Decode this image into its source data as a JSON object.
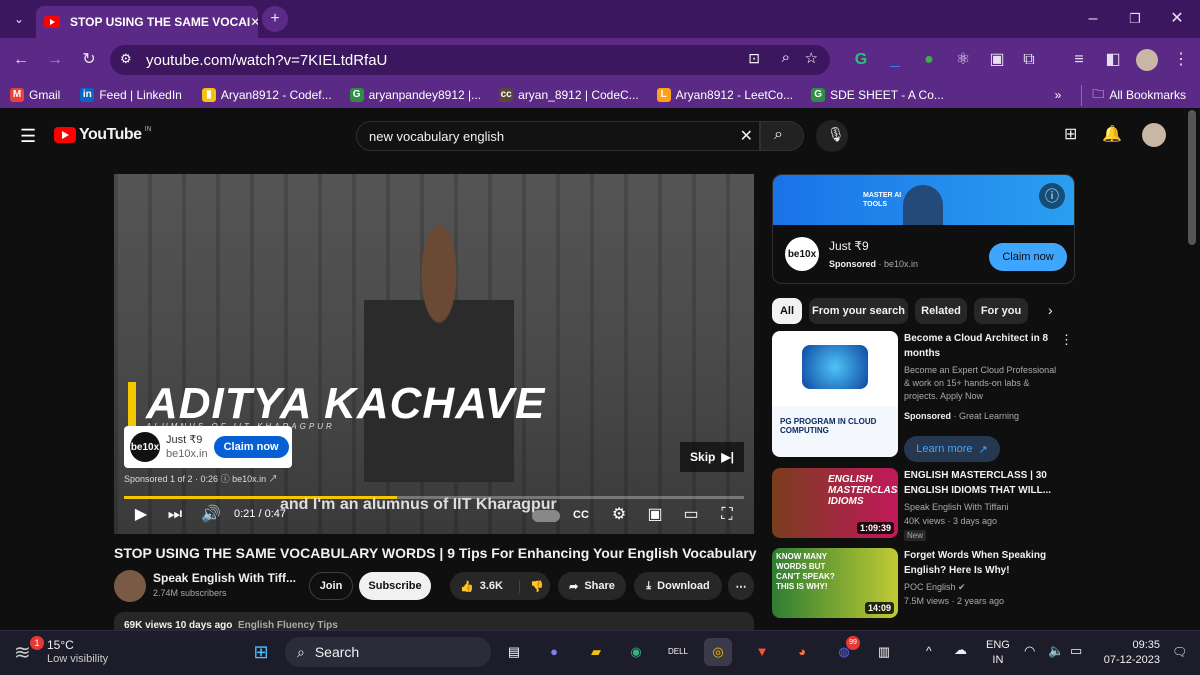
{
  "browser": {
    "tab_title": "STOP USING THE SAME VOCAI",
    "url": "youtube.com/watch?v=7KIELtdRfaU",
    "bookmarks": [
      {
        "label": "Gmail",
        "icon": "gmail-icon",
        "color": "#ea4335"
      },
      {
        "label": "Feed | LinkedIn",
        "icon": "linkedin-icon",
        "color": "#0a66c2"
      },
      {
        "label": "Aryan8912 - Codef...",
        "icon": "codeforces-icon",
        "color": "#f4c20d"
      },
      {
        "label": "aryanpandey8912 |...",
        "icon": "gfg-icon",
        "color": "#2f8d46"
      },
      {
        "label": "aryan_8912 | CodeC...",
        "icon": "codechef-icon",
        "color": "#5b4638"
      },
      {
        "label": "Aryan8912 - LeetCo...",
        "icon": "leetcode-icon",
        "color": "#ffa116"
      },
      {
        "label": "SDE SHEET - A Co...",
        "icon": "gfg-icon",
        "color": "#2f8d46"
      }
    ],
    "all_bookmarks": "All Bookmarks"
  },
  "youtube": {
    "logo": "YouTube",
    "region": "IN",
    "search_value": "new vocabulary english"
  },
  "player": {
    "overlay_name": "ADITYA KACHAVE",
    "overlay_sub": "ALUMNUS OF IIT KHARAGPUR",
    "caption": "and I'm an alumnus of IIT Kharagpur",
    "ad_price": "Just ₹9",
    "ad_domain": "be10x.in",
    "ad_claim": "Claim now",
    "ad_info": "Sponsored 1 of 2 · 0:26",
    "ad_info_domain": "be10x.in",
    "skip": "Skip",
    "time": "0:21 / 0:47",
    "progress": 0.44
  },
  "video": {
    "title": "STOP USING THE SAME VOCABULARY WORDS | 9 Tips For Enhancing Your English Vocabulary",
    "channel": "Speak English With Tiff...",
    "subscribers": "2.74M subscribers",
    "join": "Join",
    "subscribe": "Subscribe",
    "likes": "3.6K",
    "share": "Share",
    "download": "Download",
    "views_date": "69K views  10 days ago",
    "tag": "English Fluency Tips"
  },
  "side_ad": {
    "banner_text": "MASTER AI TOOLS",
    "price": "Just ₹9",
    "sponsored": "Sponsored",
    "domain": "be10x.in",
    "claim": "Claim now"
  },
  "chips": [
    "All",
    "From your search",
    "Related",
    "For you"
  ],
  "related": [
    {
      "title": "Become a Cloud Architect in 8 months",
      "desc": "Become an Expert Cloud Professional & work on 15+ hands-on labs & projects. Apply Now",
      "sponsored": "Sponsored",
      "advertiser": "Great Learning",
      "cta": "Learn more",
      "thumb_text": "PG PROGRAM IN CLOUD COMPUTING"
    },
    {
      "title": "ENGLISH MASTERCLASS | 30 ENGLISH IDIOMS THAT WILL...",
      "channel": "Speak English With Tiffani",
      "meta": "40K views · 3 days ago",
      "badge": "New",
      "duration": "1:09:39",
      "thumb_text": "ENGLISH MASTERCLASS IDIOMS"
    },
    {
      "title": "Forget Words When Speaking English? Here Is Why!",
      "channel": "POC English",
      "meta": "7.5M views · 2 years ago",
      "duration": "14:09",
      "thumb_text": "KNOW MANY WORDS BUT CAN'T SPEAK? THIS IS WHY!"
    }
  ],
  "taskbar": {
    "weather_temp": "15°C",
    "weather_desc": "Low visibility",
    "search": "Search",
    "lang": "ENG",
    "region": "IN",
    "time": "09:35",
    "date": "07-12-2023",
    "notification_count": "1",
    "discord_badge": "99"
  }
}
